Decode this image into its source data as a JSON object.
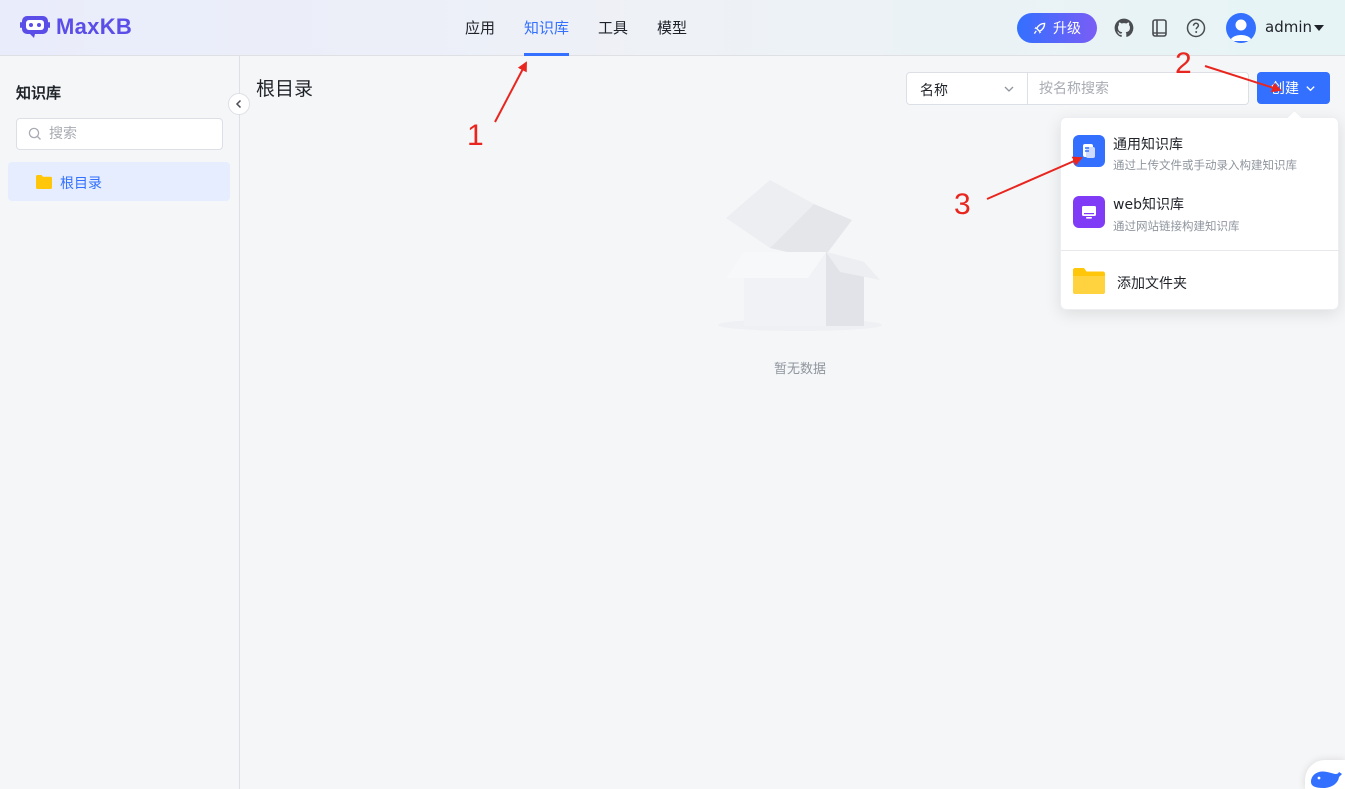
{
  "header": {
    "logo_text": "MaxKB",
    "nav": [
      {
        "label": "应用",
        "active": false
      },
      {
        "label": "知识库",
        "active": true
      },
      {
        "label": "工具",
        "active": false
      },
      {
        "label": "模型",
        "active": false
      }
    ],
    "upgrade_label": "升级",
    "icons": [
      "github-icon",
      "book-icon",
      "help-icon"
    ],
    "user_name": "admin"
  },
  "sidebar": {
    "title": "知识库",
    "search_placeholder": "搜索",
    "tree": [
      {
        "label": "根目录",
        "selected": true
      }
    ]
  },
  "main": {
    "title": "根目录",
    "filter_field": "名称",
    "search_placeholder": "按名称搜索",
    "create_label": "创建",
    "empty_text": "暂无数据"
  },
  "dropdown": {
    "items": [
      {
        "title": "通用知识库",
        "desc": "通过上传文件或手动录入构建知识库",
        "icon": "document-icon",
        "color": "#3370ff"
      },
      {
        "title": "web知识库",
        "desc": "通过网站链接构建知识库",
        "icon": "monitor-icon",
        "color": "#7f3bf5"
      },
      {
        "title": "添加文件夹",
        "icon": "folder-icon",
        "color": "#ffc60a"
      }
    ]
  },
  "annotations": [
    "1",
    "2",
    "3"
  ],
  "colors": {
    "primary": "#3370ff",
    "annotation": "#e8261f"
  }
}
